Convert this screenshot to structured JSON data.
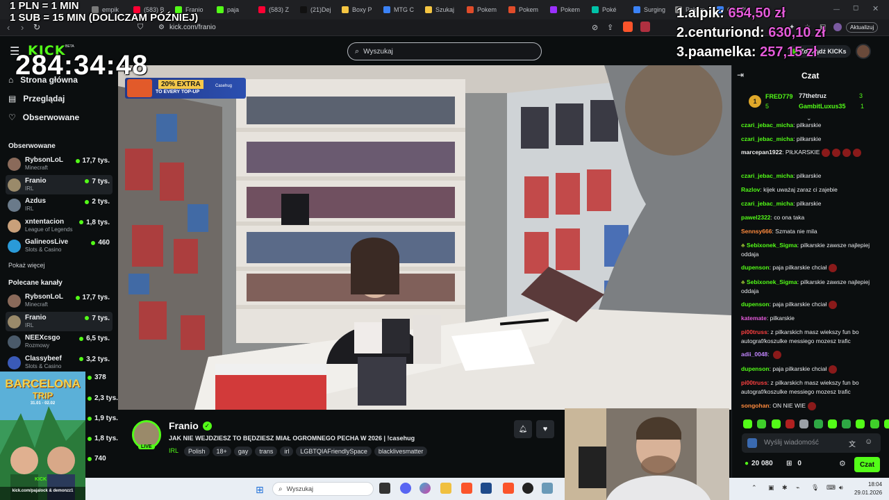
{
  "browser": {
    "tabs": [
      {
        "label": "empik",
        "color": "#7a7a7a"
      },
      {
        "label": "(583) B",
        "color": "#ff0033"
      },
      {
        "label": "Franio",
        "color": "#53fc18"
      },
      {
        "label": "paja",
        "color": "#53fc18"
      },
      {
        "label": "(583) Z",
        "color": "#ff0033"
      },
      {
        "label": "(21)Dej",
        "color": "#111111"
      },
      {
        "label": "Boxy P",
        "color": "#f4c542"
      },
      {
        "label": "MTG C",
        "color": "#3b82f6"
      },
      {
        "label": "Szukaj",
        "color": "#f4c542"
      },
      {
        "label": "Pokem",
        "color": "#e04c2a"
      },
      {
        "label": "Pokem",
        "color": "#e04c2a"
      },
      {
        "label": "Pokem",
        "color": "#9b30ff"
      },
      {
        "label": "Poké",
        "color": "#00c2a8"
      },
      {
        "label": "Surging",
        "color": "#3b82f6"
      },
      {
        "label": "Pokem",
        "color": "#888888"
      },
      {
        "label": "One Pi",
        "color": "#3b82f6"
      }
    ],
    "url": "kick.com/franio",
    "update_button": "Aktualizuj"
  },
  "overlay": {
    "rate_line1": "1 PLN = 1 MIN",
    "rate_line2": "1 SUB = 15 MIN (DOLICZAM PÓŹNIEJ)",
    "timer": "284:34:48",
    "leaderboard": [
      {
        "rank": "1.",
        "name": "alpik:",
        "amount": "654,50 zł"
      },
      {
        "rank": "2.",
        "name": "centuriond:",
        "amount": "630,10 zł"
      },
      {
        "rank": "3.",
        "name": "paamelka:",
        "amount": "257,15 zł"
      }
    ],
    "leaderboard_color": "#e25ad8",
    "promo": {
      "top": "20% EXTRA",
      "bottom": "TO EVERY TOP-UP",
      "brand": "Casehug"
    },
    "cam_event": {
      "line1": "BARCELONA",
      "line2": "TRIP",
      "dates": "31.01 - 02.02",
      "site": "kick.com/pajalock & demonzz1",
      "brand": "KICK"
    }
  },
  "kick": {
    "logo": "KICK",
    "logo_beta": "BETA",
    "search_placeholder": "Wyszukaj",
    "get_kicks": "Zdobądź KICKs",
    "accent": "#53fc18"
  },
  "sidebar": {
    "nav": [
      {
        "label": "Strona główna",
        "icon": "home-icon"
      },
      {
        "label": "Przeglądaj",
        "icon": "browse-icon"
      },
      {
        "label": "Obserwowane",
        "icon": "heart-icon"
      }
    ],
    "followed_title": "Obserwowane",
    "followed": [
      {
        "name": "RybsonLoL",
        "category": "Minecraft",
        "viewers": "17,7 tys.",
        "color": "#8a6a5a"
      },
      {
        "name": "Franio",
        "category": "IRL",
        "viewers": "7 tys.",
        "color": "#9a8a6a"
      },
      {
        "name": "Azdus",
        "category": "IRL",
        "viewers": "2 tys.",
        "color": "#6a7a8a"
      },
      {
        "name": "xntentacion",
        "category": "League of Legends",
        "viewers": "1,8 tys.",
        "color": "#c9a07a"
      },
      {
        "name": "GalineosLive",
        "category": "Slots & Casino",
        "viewers": "460",
        "color": "#2a9ad8"
      }
    ],
    "show_more": "Pokaż więcej",
    "recommended_title": "Polecane kanały",
    "recommended": [
      {
        "name": "RybsonLoL",
        "category": "Minecraft",
        "viewers": "17,7 tys.",
        "color": "#8a6a5a"
      },
      {
        "name": "Franio",
        "category": "IRL",
        "viewers": "7 tys.",
        "color": "#9a8a6a"
      },
      {
        "name": "NEEXcsgo",
        "category": "Rozmowy",
        "viewers": "6,5 tys.",
        "color": "#4a5a6a"
      },
      {
        "name": "Classybeef",
        "category": "Slots & Casino",
        "viewers": "3,2 tys.",
        "color": "#3a5ab8"
      }
    ],
    "more_viewers": [
      "378",
      "2,3 tys.",
      "1,9 tys.",
      "1,8 tys.",
      "740"
    ]
  },
  "stream": {
    "channel": "Franio",
    "live_badge": "LIVE",
    "title": "JAK NIE WEJDZIESZ TO BĘDZIESZ MIAŁ OGROMNEGO PECHA W 2026 | !casehug",
    "category": "IRL",
    "tags": [
      "Polish",
      "18+",
      "gay",
      "trans",
      "irl",
      "LGBTQIAFriendlySpace",
      "blacklivesmatter"
    ]
  },
  "chat": {
    "title": "Czat",
    "top_gifters": [
      {
        "name": "FRED779",
        "count": "5",
        "color": "#53fc18"
      },
      {
        "name": "77thetruz",
        "count": "3",
        "color": "#e8eaed"
      },
      {
        "name": "GambitLuxus35",
        "count": "1",
        "color": "#53fc18"
      }
    ],
    "messages": [
      {
        "user": "czari_jebac_micha",
        "color": "#53fc18",
        "text": "pilkarskie"
      },
      {
        "user": "czari_jebac_micha",
        "color": "#53fc18",
        "text": "pilkarskie"
      },
      {
        "user": "marcepan1922",
        "color": "#f0f0f0",
        "text": "PIŁKARSKIE"
      },
      {
        "user": "czari_jebac_micha",
        "color": "#53fc18",
        "text": "pilkarskie"
      },
      {
        "user": "Razlov",
        "color": "#53fc18",
        "text": "kijek uważaj zaraz ci zajebie"
      },
      {
        "user": "czari_jebac_micha",
        "color": "#53fc18",
        "text": "pilkarskie"
      },
      {
        "user": "pawel2322",
        "color": "#53fc18",
        "text": "co ona taka"
      },
      {
        "user": "Sennsy666",
        "color": "#ff8a3d",
        "text": "Szmata nie mila"
      },
      {
        "user": "Sebixonek_Sigma",
        "color": "#53fc18",
        "text": "pilkarskie zawsze najlepiej oddaja"
      },
      {
        "user": "dupenson",
        "color": "#53fc18",
        "text": "paja pilkarskie chciał"
      },
      {
        "user": "Sebixonek_Sigma",
        "color": "#53fc18",
        "text": "pilkarskie zawsze najlepiej oddaja"
      },
      {
        "user": "dupenson",
        "color": "#53fc18",
        "text": "paja pilkarskie chciał"
      },
      {
        "user": "katemate",
        "color": "#e25ad8",
        "text": "pilkarskie"
      },
      {
        "user": "pi00truss",
        "color": "#ff4040",
        "text": "z pilkarskich masz wiekszy fun bo autograf/koszulke messiego mozesz trafic"
      },
      {
        "user": "adii_0048",
        "color": "#c084fc",
        "text": ""
      },
      {
        "user": "dupenson",
        "color": "#53fc18",
        "text": "paja pilkarskie chciał"
      },
      {
        "user": "pi00truss",
        "color": "#ff4040",
        "text": "z pilkarskich masz wiekszy fun bo autograf/koszulke messiego mozesz trafic"
      },
      {
        "user": "songohan",
        "color": "#ff8a3d",
        "text": "ON NIE WIE"
      }
    ],
    "input_placeholder": "Wyślij wiadomość",
    "points": "20 080",
    "drops": "0",
    "send_label": "Czat"
  },
  "taskbar": {
    "search_placeholder": "Wyszukaj",
    "time": "18:04",
    "date": "29.01.2026"
  }
}
